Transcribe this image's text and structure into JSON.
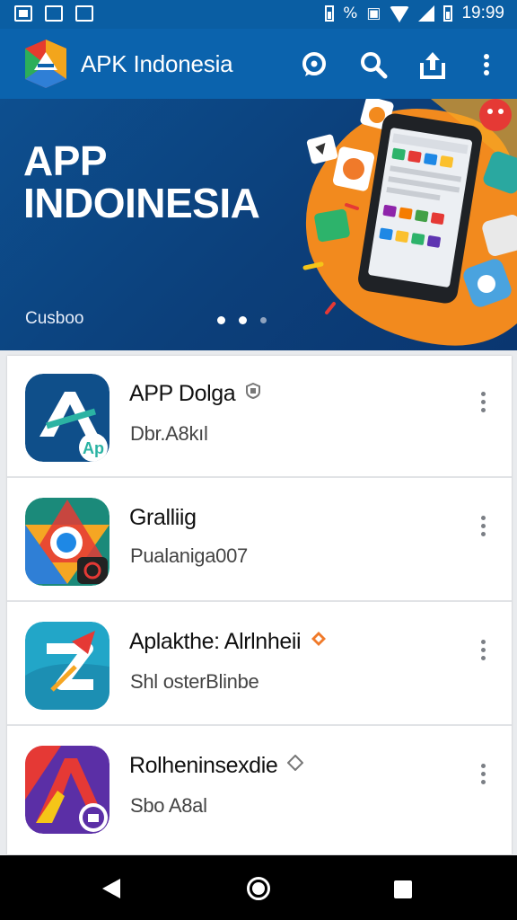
{
  "status_bar": {
    "time": "19:99",
    "percent_glyph": "%"
  },
  "app_bar": {
    "title": "APK Indonesia",
    "actions": [
      "chat-icon",
      "search-icon",
      "share-icon",
      "more-vert-icon"
    ]
  },
  "banner": {
    "title_line1": "APP",
    "title_line2": "INDOINESIA",
    "caption": "Cusboo",
    "active_slide": 1,
    "slide_count": 3
  },
  "apps": [
    {
      "name": "APP Dolga",
      "subtitle": "Dbr.A8kıl",
      "badge": "shield-badge-icon"
    },
    {
      "name": "Gralliig",
      "subtitle": "Pualaniga007",
      "badge": ""
    },
    {
      "name": "Aplakthe: Alrlnheii",
      "subtitle": "Shl osterBlinbe",
      "badge": "diamond-badge-icon"
    },
    {
      "name": "Rolheninsexdie",
      "subtitle": "Sbo A8al",
      "badge": "diamond-outline-badge-icon"
    }
  ],
  "colors": {
    "primary": "#0b63ad",
    "banner_bg": "#0c4682",
    "accent_orange": "#f28a1e"
  }
}
